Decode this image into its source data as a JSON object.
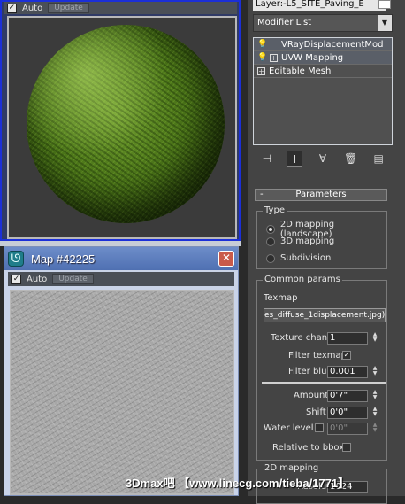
{
  "material_editor": {
    "top_preview": {
      "auto_label": "Auto",
      "update_label": "Update",
      "auto_checked": true
    },
    "map_window": {
      "title": "Map #42225",
      "close_label": "✕",
      "auto_label": "Auto",
      "update_label": "Update",
      "auto_checked": true
    }
  },
  "command_panel": {
    "layer_label": "Layer:-L5_SITE_Paving_E",
    "modifier_list": {
      "label": "Modifier List"
    },
    "stack": [
      {
        "label": "VRayDisplacementMod",
        "has_bulb": true,
        "has_plus": false
      },
      {
        "label": "UVW Mapping",
        "has_bulb": true,
        "has_plus": true
      },
      {
        "label": "Editable Mesh",
        "has_bulb": false,
        "has_plus": true
      }
    ],
    "tools": [
      "pin-stack-icon",
      "show-end-result-icon",
      "make-unique-icon",
      "remove-modifier-icon",
      "configure-sets-icon"
    ],
    "parameters": {
      "rollout_title": "Parameters",
      "rollout_toggle": "-",
      "type_group": {
        "label": "Type",
        "options": [
          "2D mapping (landscape)",
          "3D mapping",
          "Subdivision"
        ],
        "selected_index": 0
      },
      "common_group": {
        "label": "Common params",
        "texmap_label": "Texmap",
        "texmap_value": "es_diffuse_1displacement.jpg)",
        "texture_chan_label": "Texture chan",
        "texture_chan_value": "1",
        "filter_texmap_label": "Filter texmap",
        "filter_texmap_checked": true,
        "filter_blur_label": "Filter blur",
        "filter_blur_value": "0.001",
        "amount_label": "Amount",
        "amount_value": "0'7\"",
        "shift_label": "Shift",
        "shift_value": "0'0\"",
        "water_level_label": "Water level",
        "water_level_value": "0'0\"",
        "relative_bbox_label": "Relative to bbox"
      },
      "mapping_2d_group": {
        "label": "2D mapping",
        "resolution_label": "Resolution",
        "resolution_value": "1024"
      }
    }
  },
  "watermark": "3Dmax吧 【www.linecg.com/tieba/1771】"
}
